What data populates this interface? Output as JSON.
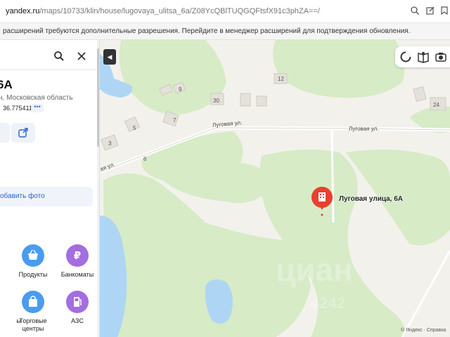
{
  "browser": {
    "url_host": "yandex.ru",
    "url_path": "/maps/10733/klin/house/lugovaya_ulitsa_6a/Z08YcQBlTUQGQFtsfX91c3phZA==/"
  },
  "notice": {
    "text": "расширений требуются дополнительные разрешения. Перейдите в менеджер расширений для подтверждения обновления."
  },
  "sidebar": {
    "search_value": "",
    "title": "6А",
    "subtitle": "н, Московская область",
    "coords": "36.775411",
    "coords_more": "•••",
    "add_photo_label": "обавить фото",
    "categories": [
      {
        "label": "Продукты",
        "icon": "basket-icon",
        "color": "#4a9cf0"
      },
      {
        "label": "Банкоматы",
        "icon": "ruble-icon",
        "color": "#a46de0"
      },
      {
        "label": "Торговые центры",
        "icon": "shopping-bag-icon",
        "color": "#4a9cf0"
      },
      {
        "label": "АЗС",
        "icon": "fuel-icon",
        "color": "#a46de0"
      },
      {
        "label": "ы",
        "icon": "partial-icon",
        "color": "#4a9cf0"
      }
    ]
  },
  "map": {
    "marker_label": "Луговая улица, 6А",
    "street_1": "Луговая ул.",
    "street_2": "Луговая ул.",
    "street_3": "ая ул.",
    "houses": [
      "12",
      "9",
      "30",
      "24",
      "5",
      "7",
      "3",
      "6"
    ],
    "copyright": "© Яндекс · Справка",
    "watermark": "циан",
    "watermark_sub": "4242",
    "colors": {
      "forest": "#d6ebc6",
      "water": "#aed6f4",
      "marker": "#e8402f",
      "land": "#f3f1ec"
    }
  }
}
